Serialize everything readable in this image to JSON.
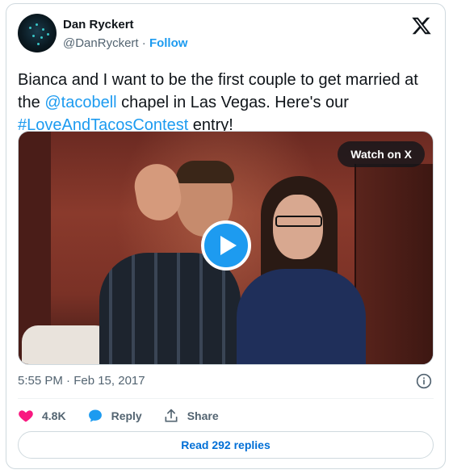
{
  "author": {
    "name": "Dan Ryckert",
    "handle": "@DanRyckert",
    "separator": "·",
    "follow_label": "Follow"
  },
  "tweet": {
    "text_part1": "Bianca and I want to be the first couple to get married at the ",
    "mention": "@tacobell",
    "text_part2": " chapel in Las Vegas. Here's our ",
    "hashtag": "#LoveAndTacosContest",
    "text_part3": " entry!"
  },
  "media": {
    "watch_label": "Watch on X",
    "play_icon": "play-icon"
  },
  "meta": {
    "timestamp": "5:55 PM · Feb 15, 2017",
    "info_icon": "info-icon"
  },
  "actions": {
    "likes": "4.8K",
    "reply_label": "Reply",
    "share_label": "Share"
  },
  "footer": {
    "read_replies_label": "Read 292 replies"
  },
  "colors": {
    "accent": "#1d9bf0",
    "like": "#f91880",
    "muted": "#536471",
    "replies_link": "#006fd6"
  }
}
